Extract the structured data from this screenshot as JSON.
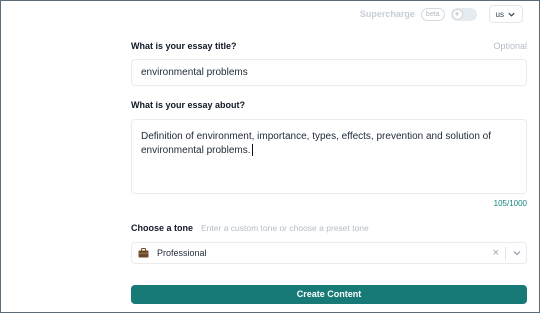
{
  "topbar": {
    "supercharge_label": "Supercharge",
    "beta_badge": "beta",
    "toggle_icon": "plus-icon",
    "language_value": "us"
  },
  "title_section": {
    "label": "What is your essay title?",
    "optional": "Optional",
    "value": "environmental problems"
  },
  "about_section": {
    "label": "What is your essay about?",
    "value": "Definition of environment, importance, types, effects, prevention and solution of environmental problems.",
    "counter": "105/1000"
  },
  "tone_section": {
    "label": "Choose a tone",
    "hint": "Enter a custom tone or choose a preset tone",
    "selected": "Professional",
    "icon": "briefcase-icon"
  },
  "actions": {
    "create_label": "Create Content"
  },
  "colors": {
    "accent": "#177a76",
    "counter": "#16857e",
    "border": "#e8ebef"
  }
}
